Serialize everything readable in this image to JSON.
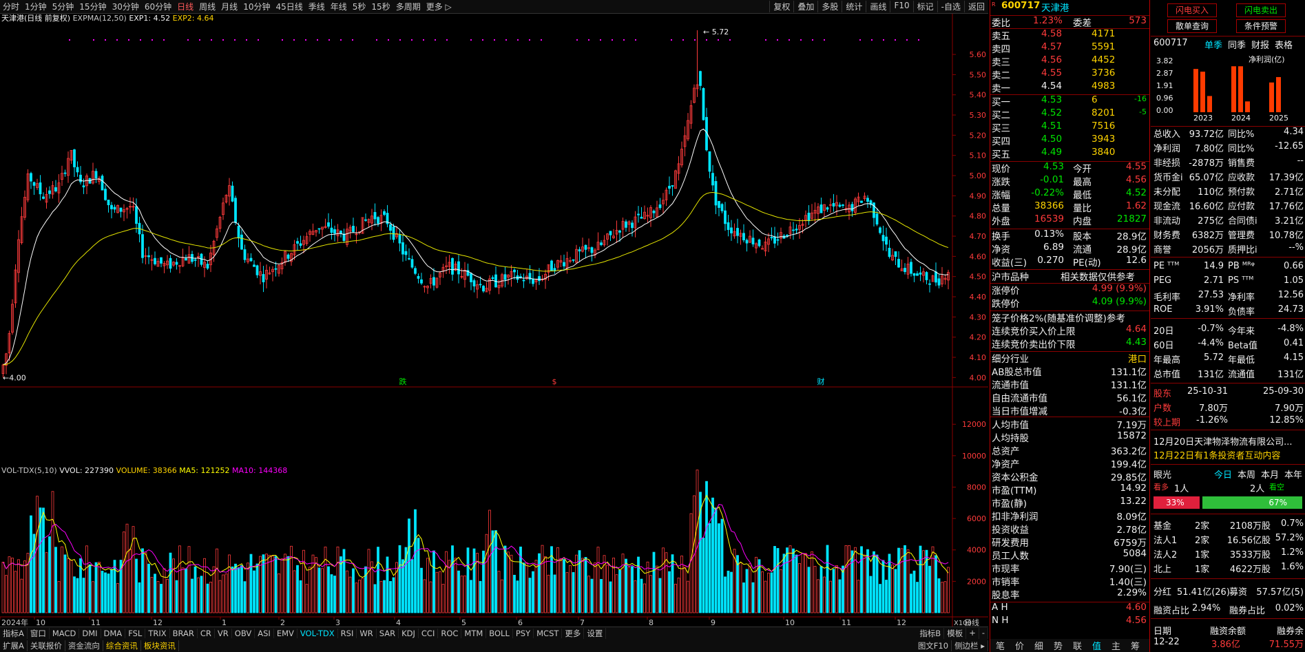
{
  "topbar": {
    "items": [
      "分时",
      "1分钟",
      "5分钟",
      "15分钟",
      "30分钟",
      "60分钟",
      "日线",
      "周线",
      "月线",
      "10分钟",
      "45日线",
      "季线",
      "年线",
      "5秒",
      "15秒",
      "多周期",
      "更多 ▷"
    ],
    "active": "日线",
    "right": [
      "复权",
      "叠加",
      "多股",
      "统计",
      "画线",
      "F10",
      "标记",
      "-自选",
      "返回"
    ]
  },
  "chart": {
    "title": "天津港(日线 前复权)",
    "indicator": "EXPMA(12,50)",
    "exp1": "EXP1: 4.52",
    "exp2": "EXP2: 4.64",
    "vol_title": "VOL-TDX(5,10)",
    "vvol": "VVOL: 227390",
    "volume": "VOLUME: 38366",
    "ma5": "MA5: 121252",
    "ma10": "MA10: 144368",
    "high_label": "5.72",
    "low_label": "4.00",
    "markers": [
      "跌",
      "$",
      "财"
    ],
    "x100": "X100",
    "period_label": "日线"
  },
  "chart_data": {
    "type": "candlestick",
    "ylim": [
      3.95,
      5.74
    ],
    "price_ticks": [
      4.0,
      4.1,
      4.2,
      4.3,
      4.4,
      4.5,
      4.6,
      4.7,
      4.8,
      4.9,
      5.0,
      5.1,
      5.2,
      5.3,
      5.4,
      5.5,
      5.6
    ],
    "vol_ylim": [
      0,
      13500
    ],
    "vol_ticks": [
      2000,
      4000,
      6000,
      8000,
      10000,
      12000
    ],
    "month_labels": [
      "2024年",
      "10",
      "11",
      "12",
      "1",
      "2",
      "3",
      "4",
      "5",
      "6",
      "7",
      "8",
      "9",
      "10",
      "11",
      "12"
    ],
    "high": 5.72,
    "low": 4.0,
    "last_close": 4.53,
    "exp1_last": 4.52,
    "exp2_last": 4.64
  },
  "quote": {
    "code": "600717",
    "name": "天津港",
    "weibi_label": "委比",
    "weibi": "1.23%",
    "weicha_label": "委差",
    "weicha": "573",
    "asks": [
      [
        "卖五",
        "4.58",
        "4171"
      ],
      [
        "卖四",
        "4.57",
        "5591"
      ],
      [
        "卖三",
        "4.56",
        "4452"
      ],
      [
        "卖二",
        "4.55",
        "3736"
      ],
      [
        "卖一",
        "4.54",
        "4983"
      ]
    ],
    "bids": [
      [
        "买一",
        "4.53",
        "6",
        "-16"
      ],
      [
        "买二",
        "4.52",
        "8201",
        "-5"
      ],
      [
        "买三",
        "4.51",
        "7516",
        ""
      ],
      [
        "买四",
        "4.50",
        "3943",
        ""
      ],
      [
        "买五",
        "4.49",
        "3840",
        ""
      ]
    ],
    "stats": [
      [
        "现价",
        "4.53",
        "今开",
        "4.55"
      ],
      [
        "涨跌",
        "-0.01",
        "最高",
        "4.56"
      ],
      [
        "涨幅",
        "-0.22%",
        "最低",
        "4.52"
      ],
      [
        "总量",
        "38366",
        "量比",
        "1.62"
      ],
      [
        "外盘",
        "16539",
        "内盘",
        "21827"
      ]
    ],
    "stats2": [
      [
        "换手",
        "0.13%",
        "股本",
        "28.9亿"
      ],
      [
        "净资",
        "6.89",
        "流通",
        "28.9亿"
      ],
      [
        "收益(三)",
        "0.270",
        "PE(动)",
        "12.6"
      ]
    ],
    "hu_label": "沪市品种",
    "hu_note": "相关数据仅供参考",
    "limit": [
      [
        "涨停价",
        "4.99 (9.9%)"
      ],
      [
        "跌停价",
        "4.09 (9.9%)"
      ]
    ],
    "cage": "笼子价格2%(随基准价调整)参考",
    "cage_rows": [
      [
        "连续竞价买入价上限",
        "4.64"
      ],
      [
        "连续竞价卖出价下限",
        "4.43"
      ]
    ],
    "industry_label": "细分行业",
    "industry": "港口",
    "fund": [
      [
        "AB股总市值",
        "131.1亿"
      ],
      [
        "流通市值",
        "131.1亿"
      ],
      [
        "自由流通市值",
        "56.1亿"
      ],
      [
        "当日市值增减",
        "-0.3亿"
      ],
      [
        "人均市值",
        "7.19万"
      ],
      [
        "人均持股",
        "15872"
      ],
      [
        "总资产",
        "363.2亿"
      ],
      [
        "净资产",
        "199.4亿"
      ],
      [
        "资本公积金",
        "29.85亿"
      ],
      [
        "市盈(TTM)",
        "14.92"
      ],
      [
        "市盈(静)",
        "13.22"
      ],
      [
        "扣非净利润",
        "8.09亿"
      ],
      [
        "投资收益",
        "2.78亿"
      ],
      [
        "研发费用",
        "6759万"
      ],
      [
        "员工人数",
        "5084"
      ],
      [
        "市现率",
        "7.90(三)"
      ],
      [
        "市销率",
        "1.40(三)"
      ],
      [
        "股息率",
        "2.29%"
      ]
    ],
    "ah": [
      [
        "A H",
        "4.60"
      ],
      [
        "N H",
        "4.56"
      ]
    ],
    "tabs": [
      "笔",
      "价",
      "细",
      "势",
      "联",
      "值",
      "主",
      "筹"
    ]
  },
  "right": {
    "buttons": [
      "闪电买入",
      "闪电卖出",
      "散单查询",
      "条件预警"
    ],
    "code": "600717",
    "tabs": [
      "单季",
      "同季",
      "财报",
      "表格"
    ],
    "profit_label": "净利润(亿)",
    "profit_y": [
      "3.82",
      "2.87",
      "1.91",
      "0.96",
      "0.00"
    ],
    "years": [
      "2023",
      "2024",
      "2025"
    ],
    "profit_bars": [
      0.0,
      3.2,
      3.0,
      1.2,
      0.0,
      3.4,
      3.4,
      0.8,
      0.0,
      2.2,
      2.6,
      0.0
    ],
    "fin": [
      [
        "总收入",
        "93.72亿",
        "同比%",
        "4.34"
      ],
      [
        "净利润",
        "7.80亿",
        "同比%",
        "-12.65"
      ],
      [
        "非经损",
        "-2878万",
        "销售费",
        "--"
      ],
      [
        "货币金i",
        "65.07亿",
        "应收款",
        "17.39亿"
      ],
      [
        "未分配",
        "110亿",
        "预付款",
        "2.71亿"
      ],
      [
        "现金流",
        "16.60亿",
        "应付款",
        "17.76亿"
      ],
      [
        "非流动",
        "275亿",
        "合同债i",
        "3.21亿"
      ],
      [
        "财务费",
        "6382万",
        "管理费",
        "10.78亿"
      ],
      [
        "商誉",
        "2056万",
        "质押比i",
        "--%"
      ]
    ],
    "val": [
      [
        "PE ᵀᵀᴹ",
        "14.9",
        "PB ᴹᴿᵠ",
        "0.66"
      ],
      [
        "PEG",
        "2.71",
        "PS ᵀᵀᴹ",
        "1.05"
      ],
      [
        "毛利率",
        "27.53",
        "净利率",
        "12.56"
      ],
      [
        "ROE",
        "3.91%",
        "负债率",
        "24.73"
      ]
    ],
    "perf": [
      [
        "20日",
        "-0.7%",
        "今年来",
        "-4.8%"
      ],
      [
        "60日",
        "-4.4%",
        "Beta值",
        "0.41"
      ],
      [
        "年最高",
        "5.72",
        "年最低",
        "4.15"
      ],
      [
        "总市值",
        "131亿",
        "流通值",
        "131亿"
      ]
    ],
    "holders": [
      [
        "股东",
        "25-10-31",
        "25-09-30"
      ],
      [
        "户数",
        "7.80万",
        "7.90万"
      ],
      [
        "较上期",
        "-1.26%",
        "12.85%"
      ]
    ],
    "news1": "12月20日天津物泽物流有限公司...",
    "news2": "12月22日有1条投资者互动内容",
    "eye_label": "眼光",
    "eye_tabs": [
      "今日",
      "本周",
      "本月",
      "本年"
    ],
    "bull": "看多",
    "bull_n": "1人",
    "bear": "2人",
    "bear_label": "看空",
    "bull_pct": "33%",
    "bear_pct": "67%",
    "inst": [
      [
        "基金",
        "2家",
        "2108万股",
        "0.7%"
      ],
      [
        "法人1",
        "2家",
        "16.56亿股",
        "57.2%"
      ],
      [
        "法人2",
        "1家",
        "3533万股",
        "1.2%"
      ],
      [
        "北上",
        "1家",
        "4622万股",
        "1.6%"
      ]
    ],
    "div": [
      "分红",
      "51.41亿(26)",
      "募资",
      "57.57亿(5)"
    ],
    "margin": [
      "融资占比",
      "2.94%",
      "融券占比",
      "0.02%"
    ],
    "date_hdr": [
      "日期",
      "融资余额",
      "融券余"
    ],
    "date_row": [
      "12-22",
      "3.86亿",
      "71.55万"
    ]
  },
  "bottombar": {
    "items": [
      "指标A",
      "窗口",
      "MACD",
      "DMI",
      "DMA",
      "FSL",
      "TRIX",
      "BRAR",
      "CR",
      "VR",
      "OBV",
      "ASI",
      "EMV",
      "VOL-TDX",
      "RSI",
      "WR",
      "SAR",
      "KDJ",
      "CCI",
      "ROC",
      "MTM",
      "BOLL",
      "PSY",
      "MCST",
      "更多",
      "设置"
    ],
    "active": "VOL-TDX",
    "right": [
      "指标B",
      "模板",
      "+",
      "-"
    ]
  },
  "statusbar": {
    "items": [
      "扩展A",
      "关联报价",
      "资金流向",
      "综合资讯",
      "板块资讯"
    ],
    "hl": [
      "综合资讯",
      "板块资讯"
    ],
    "right": [
      "图文F10",
      "侧边栏 ▸"
    ]
  },
  "colors": {
    "up": "#ff3b3b",
    "down": "#00e5ff",
    "exp1": "#ffffff",
    "exp2": "#e6e600",
    "ma5": "#ffff00",
    "ma10": "#ff00ff",
    "grid": "#8b0000"
  }
}
